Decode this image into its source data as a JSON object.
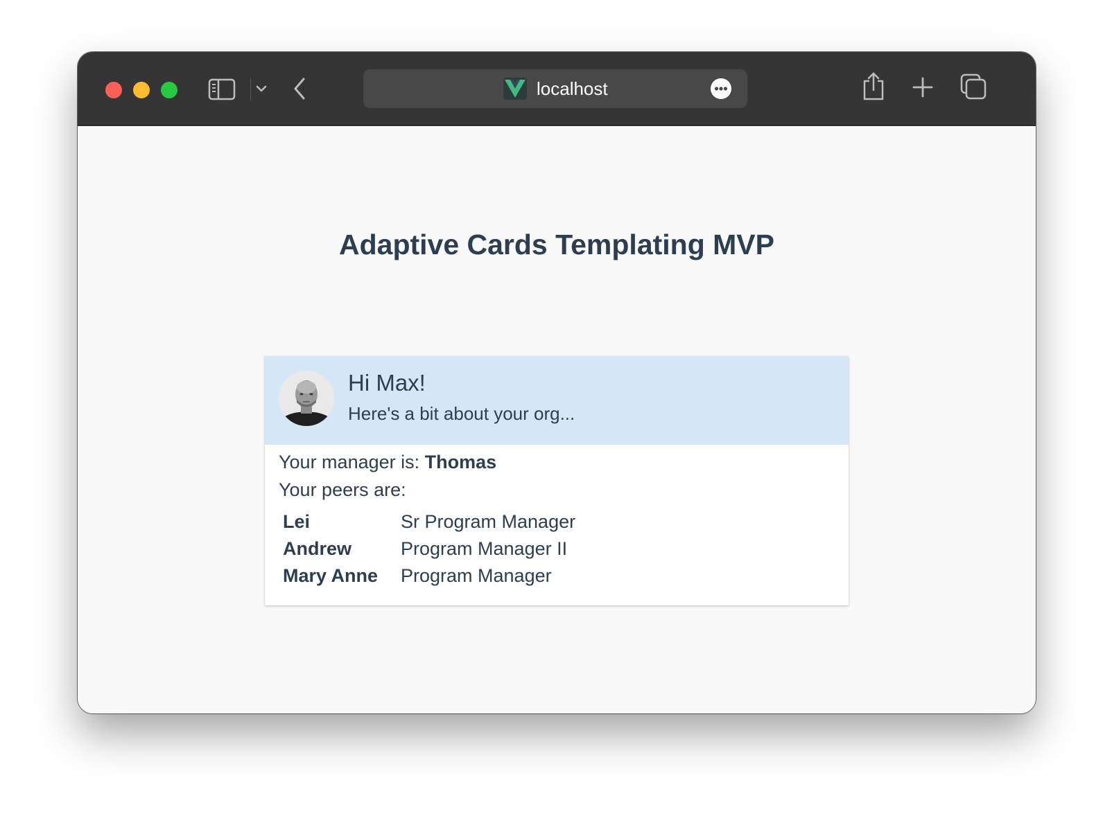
{
  "browser": {
    "url": "localhost",
    "colors": {
      "titlebar": "#353535",
      "urlbar": "#484848",
      "close": "#fe5f57",
      "minimize": "#febc2e",
      "zoom": "#28c840",
      "vue_green": "#42b883"
    }
  },
  "page": {
    "title": "Adaptive Cards Templating MVP"
  },
  "card": {
    "greeting": "Hi Max!",
    "subtitle": "Here's a bit about your org...",
    "manager_prefix": "Your manager is: ",
    "manager_name": "Thomas",
    "peers_label": "Your peers are:",
    "peers": [
      {
        "name": "Lei",
        "title": "Sr Program Manager"
      },
      {
        "name": "Andrew",
        "title": "Program Manager II"
      },
      {
        "name": "Mary Anne",
        "title": "Program Manager"
      }
    ],
    "colors": {
      "header_bg": "#d5e6f7",
      "text": "#2c3e50"
    }
  }
}
